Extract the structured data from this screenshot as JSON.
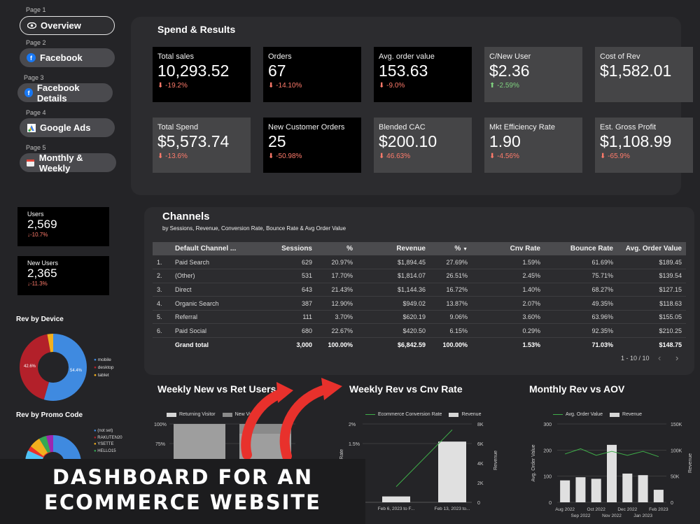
{
  "nav": {
    "items": [
      {
        "page": "Page 1",
        "label": "Overview",
        "icon": "eye-icon"
      },
      {
        "page": "Page 2",
        "label": "Facebook",
        "icon": "facebook-icon"
      },
      {
        "page": "Page 3",
        "label": "Facebook Details",
        "icon": "facebook-icon"
      },
      {
        "page": "Page 4",
        "label": "Google Ads",
        "icon": "google-ads-icon"
      },
      {
        "page": "Page 5",
        "label": "Monthly & Weekly",
        "icon": "calendar-icon"
      }
    ]
  },
  "spend": {
    "title": "Spend & Results",
    "kpis": [
      {
        "label": "Total sales",
        "value": "10,293.52",
        "change": "-19.2%"
      },
      {
        "label": "Orders",
        "value": "67",
        "change": "-14.10%"
      },
      {
        "label": "Avg. order value",
        "value": "153.63",
        "change": "-9.0%"
      },
      {
        "label": "C/New User",
        "value": "$2.36",
        "change": "-2.59%"
      },
      {
        "label": "Cost of Rev",
        "value": "$1,582.01",
        "change": ""
      },
      {
        "label": "Total Spend",
        "value": "$5,573.74",
        "change": "-13.6%"
      },
      {
        "label": "New Customer Orders",
        "value": "25",
        "change": "-50.98%"
      },
      {
        "label": "Blended CAC",
        "value": "$200.10",
        "change": "46.63%"
      },
      {
        "label": "Mkt Efficiency Rate",
        "value": "1.90",
        "change": "-4.56%"
      },
      {
        "label": "Est. Gross Profit",
        "value": "$1,108.99",
        "change": "-65.9%"
      }
    ]
  },
  "users": {
    "label": "Users",
    "value": "2,569",
    "change": "-10.7%"
  },
  "new_users": {
    "label": "New Users",
    "value": "2,365",
    "change": "-11.3%"
  },
  "rev_by_device": {
    "title": "Rev by Device",
    "legend": [
      "mobile",
      "desktop",
      "tablet"
    ],
    "labels": [
      "54.4%",
      "42.6%"
    ]
  },
  "rev_by_promo": {
    "title": "Rev by Promo Code",
    "legend": [
      "(not set)",
      "RAKUTEN20",
      "YSETTE",
      "HELLO15"
    ]
  },
  "channels": {
    "title": "Channels",
    "subtitle": "by  Sessions, Revenue, Conversion Rate, Bounce Rate & Avg Order Value",
    "headers": [
      "Default Channel ...",
      "Sessions",
      "%",
      "Revenue",
      "%",
      "Cnv Rate",
      "Bounce Rate",
      "Avg. Order Value"
    ],
    "rows": [
      {
        "n": "1.",
        "cells": [
          "Paid Search",
          "629",
          "20.97%",
          "$1,894.45",
          "27.69%",
          "1.59%",
          "61.69%",
          "$189.45"
        ]
      },
      {
        "n": "2.",
        "cells": [
          "(Other)",
          "531",
          "17.70%",
          "$1,814.07",
          "26.51%",
          "2.45%",
          "75.71%",
          "$139.54"
        ]
      },
      {
        "n": "3.",
        "cells": [
          "Direct",
          "643",
          "21.43%",
          "$1,144.36",
          "16.72%",
          "1.40%",
          "68.27%",
          "$127.15"
        ]
      },
      {
        "n": "4.",
        "cells": [
          "Organic Search",
          "387",
          "12.90%",
          "$949.02",
          "13.87%",
          "2.07%",
          "49.35%",
          "$118.63"
        ]
      },
      {
        "n": "5.",
        "cells": [
          "Referral",
          "111",
          "3.70%",
          "$620.19",
          "9.06%",
          "3.60%",
          "63.96%",
          "$155.05"
        ]
      },
      {
        "n": "6.",
        "cells": [
          "Paid Social",
          "680",
          "22.67%",
          "$420.50",
          "6.15%",
          "0.29%",
          "92.35%",
          "$210.25"
        ]
      }
    ],
    "total": [
      "Grand total",
      "3,000",
      "100.00%",
      "$6,842.59",
      "100.00%",
      "1.53%",
      "71.03%",
      "$148.75"
    ],
    "pagination": "1 - 10 / 10"
  },
  "chart_data": [
    {
      "type": "bar",
      "title": "Weekly New vs Ret Users",
      "legend": [
        "Returning Visitor",
        "New Visitor"
      ],
      "yticks": [
        "100%",
        "75%"
      ]
    },
    {
      "type": "bar",
      "title": "Weekly Rev vs Cnv Rate",
      "legend": [
        "Ecommerce Conversion Rate",
        "Revenue"
      ],
      "categories": [
        "Feb 6, 2023 to F...",
        "Feb 13, 2023 to..."
      ],
      "series": [
        {
          "name": "Revenue",
          "values": [
            600,
            6200
          ]
        },
        {
          "name": "Ecommerce Conversion Rate",
          "values": [
            0.4,
            1.85
          ]
        }
      ],
      "y_left_ticks": [
        "2%",
        "1.5%"
      ],
      "y_right_ticks": [
        "8K",
        "6K",
        "4K",
        "2K",
        "0"
      ],
      "ylabel_left": "Conversion Rate",
      "ylabel_right": "Revenue"
    },
    {
      "type": "bar",
      "title": "Monthly Rev vs AOV",
      "legend": [
        "Avg. Order Value",
        "Revenue"
      ],
      "categories": [
        "Aug 2022",
        "Sep 2022",
        "Oct 2022",
        "Nov 2022",
        "Dec 2022",
        "Jan 2023",
        "Feb 2023"
      ],
      "series": [
        {
          "name": "Revenue",
          "values": [
            42000,
            48000,
            45000,
            110000,
            55000,
            52000,
            24000
          ]
        },
        {
          "name": "Avg. Order Value",
          "values": [
            185,
            205,
            180,
            195,
            180,
            195,
            175
          ]
        }
      ],
      "y_left_ticks": [
        "300",
        "200",
        "100",
        "0"
      ],
      "y_right_ticks": [
        "150K",
        "100K",
        "50K",
        "0"
      ],
      "ylabel_left": "Avg. Order Value",
      "ylabel_right": "Revenue"
    }
  ],
  "banner": {
    "line1": "DASHBOARD FOR AN",
    "line2": "ECOMMERCE WEBSITE"
  },
  "colors": {
    "mobile": "#3f8ae0",
    "desktop": "#b3202a",
    "tablet": "#f2b01e",
    "arrow": "#e8312c"
  }
}
